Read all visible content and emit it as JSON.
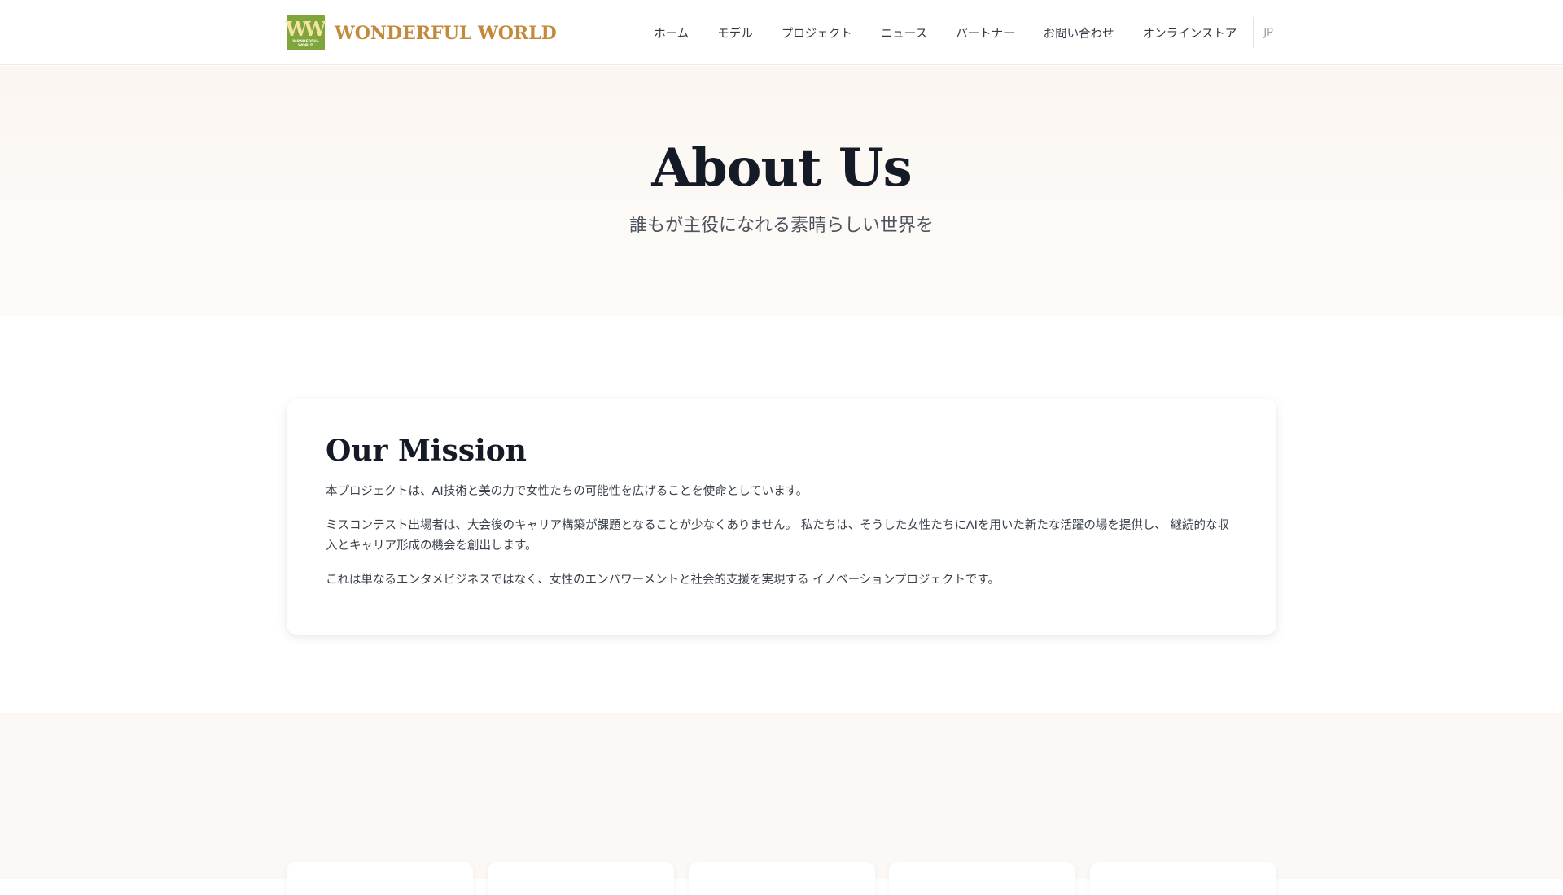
{
  "header": {
    "logo_mark": "WW",
    "logo_mini": "WONDERFUL WORLD",
    "logo_text": "WONDERFUL WORLD",
    "nav": [
      {
        "label": "ホーム"
      },
      {
        "label": "モデル"
      },
      {
        "label": "プロジェクト"
      },
      {
        "label": "ニュース"
      },
      {
        "label": "パートナー"
      },
      {
        "label": "お問い合わせ"
      },
      {
        "label": "オンラインストア"
      }
    ],
    "lang": "JP"
  },
  "hero": {
    "title": "About Us",
    "subtitle": "誰もが主役になれる素晴らしい世界を"
  },
  "mission": {
    "title": "Our Mission",
    "paragraphs": [
      "本プロジェクトは、AI技術と美の力で女性たちの可能性を広げることを使命としています。",
      "ミスコンテスト出場者は、大会後のキャリア構築が課題となることが少なくありません。 私たちは、そうした女性たちにAIを用いた新たな活躍の場を提供し、 継続的な収入とキャリア形成の機会を創出します。",
      "これは単なるエンタメビジネスではなく、女性のエンパワーメントと社会的支援を実現する イノベーションプロジェクトです。"
    ]
  },
  "colors": {
    "logo_green": "#7ea63a",
    "logo_gold": "#c28a3c",
    "hero_bg": "#fbf6f1",
    "section_bg": "#fcf8f5",
    "title_dark": "#151b26"
  }
}
